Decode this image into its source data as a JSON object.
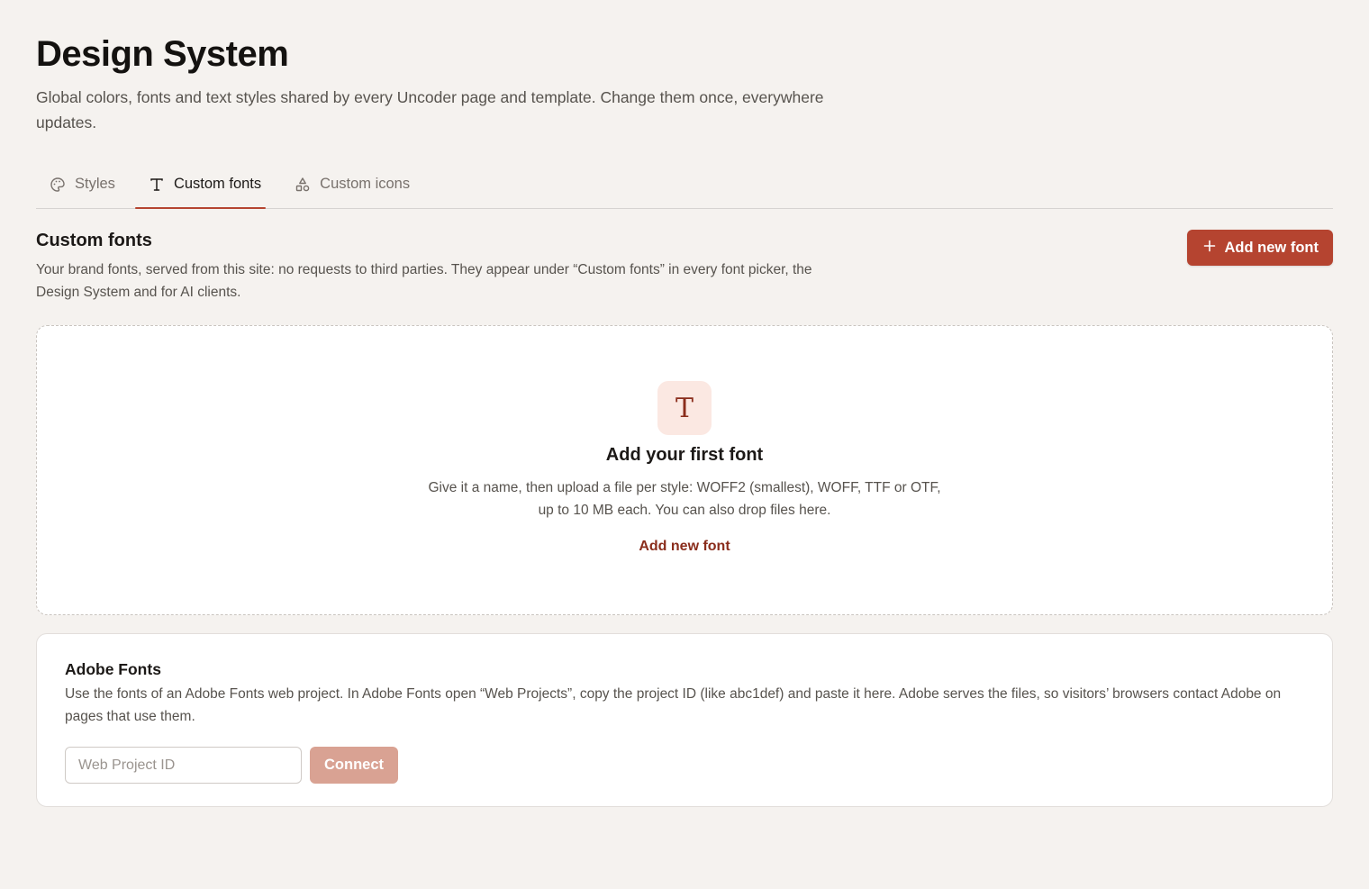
{
  "header": {
    "title": "Design System",
    "subtitle": "Global colors, fonts and text styles shared by every Uncoder page and template. Change them once, everywhere updates."
  },
  "tabs": [
    {
      "label": "Styles",
      "icon": "palette-icon",
      "active": false
    },
    {
      "label": "Custom fonts",
      "icon": "type-icon",
      "active": true
    },
    {
      "label": "Custom icons",
      "icon": "shapes-icon",
      "active": false
    }
  ],
  "custom_fonts": {
    "title": "Custom fonts",
    "description": "Your brand fonts, served from this site: no requests to third parties. They appear under “Custom fonts” in every font picker, the Design System and for AI clients.",
    "add_button_label": "Add new font",
    "add_button_icon": "plus-icon"
  },
  "empty_state": {
    "icon_glyph": "T",
    "title": "Add your first font",
    "description": "Give it a name, then upload a file per style: WOFF2 (smallest), WOFF, TTF or OTF, up to 10 MB each. You can also drop files here.",
    "link_label": "Add new font"
  },
  "adobe_fonts": {
    "title": "Adobe Fonts",
    "description": "Use the fonts of an Adobe Fonts web project. In Adobe Fonts open “Web Projects”, copy the project ID (like abc1def) and paste it here. Adobe serves the files, so visitors’ browsers contact Adobe on pages that use them.",
    "input_placeholder": "Web Project ID",
    "input_value": "",
    "connect_label": "Connect"
  },
  "colors": {
    "background": "#f5f2ef",
    "accent": "#b54430",
    "accent_dark": "#8a2d1c",
    "accent_disabled": "#d9a293",
    "icon_tile": "#fbe8e2"
  }
}
